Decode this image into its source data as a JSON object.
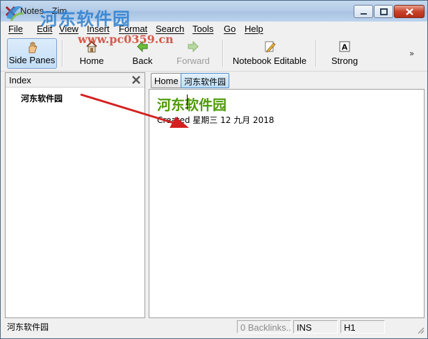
{
  "window": {
    "title": "Notes - Zim",
    "minimize_icon": "minimize-icon",
    "maximize_icon": "maximize-icon",
    "close_icon": "close-icon"
  },
  "watermark": {
    "title": "河东软件园",
    "url": "www.pc0359.cn"
  },
  "menubar": {
    "items": [
      "File",
      "Edit",
      "View",
      "Insert",
      "Format",
      "Search",
      "Tools",
      "Go",
      "Help"
    ]
  },
  "toolbar": {
    "side_panes": "Side Panes",
    "home": "Home",
    "back": "Back",
    "forward": "Forward",
    "notebook_editable": "Notebook Editable",
    "strong": "Strong",
    "overflow": "»"
  },
  "sidepane": {
    "title": "Index",
    "items": [
      "河东软件园"
    ]
  },
  "pathbar": {
    "home": "Home",
    "current": "河东软件园"
  },
  "editor": {
    "heading": "河东软件园",
    "created": "Created 星期三 12 九月 2018",
    "heading_color": "#4e9a06"
  },
  "statusbar": {
    "page": "河东软件园",
    "backlinks": "0 Backlinks...",
    "mode": "INS",
    "style": "H1"
  },
  "colors": {
    "annotation_arrow": "#d42020"
  }
}
